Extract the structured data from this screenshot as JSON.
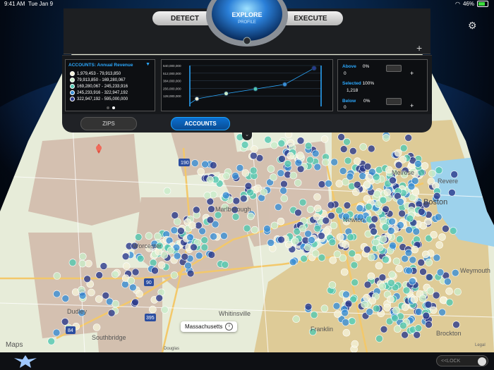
{
  "status_bar": {
    "time": "9:41 AM",
    "date": "Tue Jan 9",
    "battery_pct": "46%",
    "signal_icon": "wifi-icon"
  },
  "toolbar": {
    "detect_label": "DETECT",
    "explore_label": "EXPLORE",
    "profile_label": "PROFILE",
    "execute_label": "EXECUTE",
    "settings_icon": "gear-icon",
    "add_icon": "plus-icon"
  },
  "legend": {
    "title": "ACCOUNTS: Annual Revenue",
    "items": [
      {
        "range": "1,979,453 - 79,913,850",
        "color": "#f4f1d8"
      },
      {
        "range": "79,913,850 - 169,280,067",
        "color": "#c9ecc9"
      },
      {
        "range": "169,280,067 - 245,233,916",
        "color": "#52c8b0"
      },
      {
        "range": "245,233,916 - 322,947,192",
        "color": "#3a8fd6"
      },
      {
        "range": "322,947,192 - 595,000,000",
        "color": "#2a3a8c"
      }
    ],
    "page": 2,
    "page_count": 2
  },
  "chart_data": {
    "type": "line",
    "y_ticks": [
      "640,000,000",
      "512,000,000",
      "384,000,000",
      "256,000,000",
      "128,000,000"
    ],
    "ylim": [
      0,
      640000000
    ],
    "values": [
      79913850,
      169280067,
      245233916,
      322947192,
      595000000
    ]
  },
  "filter": {
    "above_label": "Above",
    "above_pct": "0%",
    "above_count": "0",
    "selected_label": "Selected",
    "selected_pct": "100%",
    "selected_count": "1,218",
    "below_label": "Below",
    "below_pct": "0%",
    "below_count": "0"
  },
  "modes": {
    "zips_label": "ZIPS",
    "accounts_label": "ACCOUNTS",
    "active": "ACCOUNTS"
  },
  "map": {
    "callout": "Massachusetts",
    "attribution": "Maps",
    "legal": "Legal",
    "labels": [
      "Worcester",
      "Marlborough",
      "Newton",
      "Boston",
      "Whitinsville",
      "Southbridge",
      "Franklin",
      "Brockton",
      "Weymouth",
      "Revere",
      "Melrose",
      "Dudley",
      "Douglas"
    ],
    "highways": [
      "190",
      "90",
      "395",
      "84"
    ]
  },
  "lock": {
    "label": "<<LOCK"
  },
  "accent": "#2ba9ff"
}
